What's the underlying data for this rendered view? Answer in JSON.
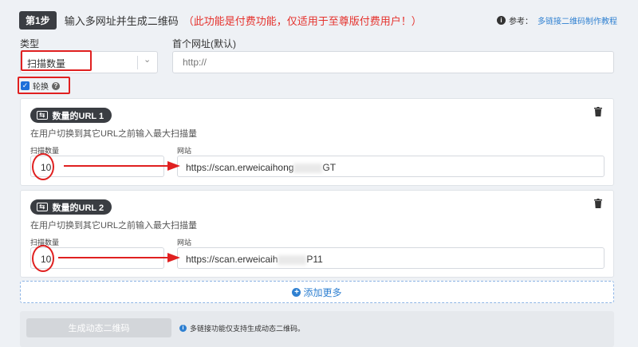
{
  "header": {
    "step_badge": "第1步",
    "step_text": "输入多网址并生成二维码",
    "step_note": "（此功能是付费功能，仅适用于至尊版付费用户！）",
    "ref_label": "参考：",
    "ref_link": "多链接二维码制作教程"
  },
  "form": {
    "type_label": "类型",
    "type_value": "扫描数量",
    "first_url_label": "首个网址(默认)",
    "first_url_placeholder": "http://",
    "rotate_label": "轮换"
  },
  "cards": [
    {
      "tag": "数量的URL 1",
      "desc": "在用户切换到其它URL之前输入最大扫描量",
      "count_label": "扫描数量",
      "count_value": "10",
      "site_label": "网站",
      "site_prefix": "https://scan.erweicaihong",
      "site_suffix": "GT"
    },
    {
      "tag": "数量的URL 2",
      "desc": "在用户切换到其它URL之前输入最大扫描量",
      "count_label": "扫描数量",
      "count_value": "10",
      "site_label": "网站",
      "site_prefix": "https://scan.erweicaih",
      "site_suffix": "P11"
    }
  ],
  "add_more": "添加更多",
  "footer": {
    "generate_button": "生成动态二维码",
    "note": "多链接功能仅支持生成动态二维码。"
  },
  "colors": {
    "accent": "#2f80d1",
    "annotation_red": "#e02020",
    "dark_badge": "#3a3d42"
  }
}
